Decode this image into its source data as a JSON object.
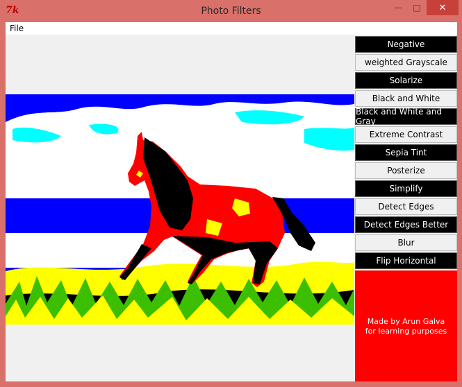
{
  "window": {
    "title": "Photo Filters",
    "app_icon": "7k"
  },
  "controls": {
    "minimize": "—",
    "maximize": "□",
    "close": "✕"
  },
  "menu": {
    "file": "File"
  },
  "filters": [
    {
      "label": "Negative",
      "style": "dark"
    },
    {
      "label": "weighted Grayscale",
      "style": "light"
    },
    {
      "label": "Solarize",
      "style": "dark"
    },
    {
      "label": "Black and White",
      "style": "light"
    },
    {
      "label": "Black and White and Gray",
      "style": "dark"
    },
    {
      "label": "Extreme Contrast",
      "style": "light"
    },
    {
      "label": "Sepia Tint",
      "style": "dark"
    },
    {
      "label": "Posterize",
      "style": "light"
    },
    {
      "label": "Simplify",
      "style": "dark"
    },
    {
      "label": "Detect Edges",
      "style": "light"
    },
    {
      "label": "Detect Edges Better",
      "style": "dark"
    },
    {
      "label": "Blur",
      "style": "light"
    },
    {
      "label": "Flip Horizontal",
      "style": "dark"
    }
  ],
  "credit": {
    "line1": "Made by Arun Galva",
    "line2": "for learning purposes"
  },
  "colors": {
    "titlebar": "#d9706a",
    "close": "#c7413a",
    "panel": "#ff0000",
    "sky": "#0000ff",
    "grass": "#ffff00"
  }
}
